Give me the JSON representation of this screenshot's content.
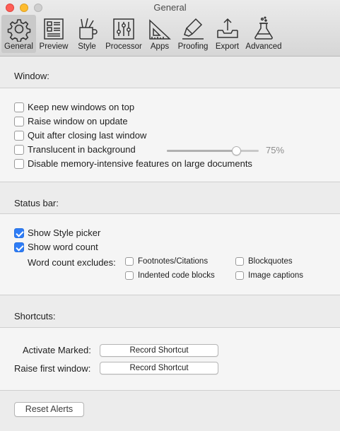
{
  "window": {
    "title": "General"
  },
  "toolbar": {
    "items": [
      {
        "label": "General",
        "icon": "gear-icon",
        "active": true
      },
      {
        "label": "Preview",
        "icon": "document-preview-icon",
        "active": false
      },
      {
        "label": "Style",
        "icon": "pencil-cup-icon",
        "active": false
      },
      {
        "label": "Processor",
        "icon": "sliders-icon",
        "active": false
      },
      {
        "label": "Apps",
        "icon": "set-square-icon",
        "active": false
      },
      {
        "label": "Proofing",
        "icon": "highlighter-icon",
        "active": false
      },
      {
        "label": "Export",
        "icon": "export-tray-icon",
        "active": false
      },
      {
        "label": "Advanced",
        "icon": "flask-icon",
        "active": false
      }
    ]
  },
  "window_section": {
    "header": "Window:",
    "options": [
      {
        "label": "Keep new windows on top",
        "checked": false
      },
      {
        "label": "Raise window on update",
        "checked": false
      },
      {
        "label": "Quit after closing last window",
        "checked": false
      },
      {
        "label": "Translucent in background",
        "checked": false
      },
      {
        "label": "Disable memory-intensive features on large documents",
        "checked": false
      }
    ],
    "translucency": {
      "value": 75,
      "display": "75%"
    }
  },
  "status_section": {
    "header": "Status bar:",
    "options": [
      {
        "label": "Show Style picker",
        "checked": true
      },
      {
        "label": "Show word count",
        "checked": true
      }
    ],
    "excludes_label": "Word count excludes:",
    "excludes": [
      {
        "label": "Footnotes/Citations",
        "checked": false
      },
      {
        "label": "Blockquotes",
        "checked": false
      },
      {
        "label": "Indented code blocks",
        "checked": false
      },
      {
        "label": "Image captions",
        "checked": false
      }
    ]
  },
  "shortcuts_section": {
    "header": "Shortcuts:",
    "rows": [
      {
        "label": "Activate Marked:",
        "button": "Record Shortcut"
      },
      {
        "label": "Raise first window:",
        "button": "Record Shortcut"
      }
    ]
  },
  "footer": {
    "reset_label": "Reset Alerts"
  },
  "colors": {
    "accent": "#2e7cf6",
    "close": "#fe5f57",
    "minimize": "#febc2e"
  }
}
